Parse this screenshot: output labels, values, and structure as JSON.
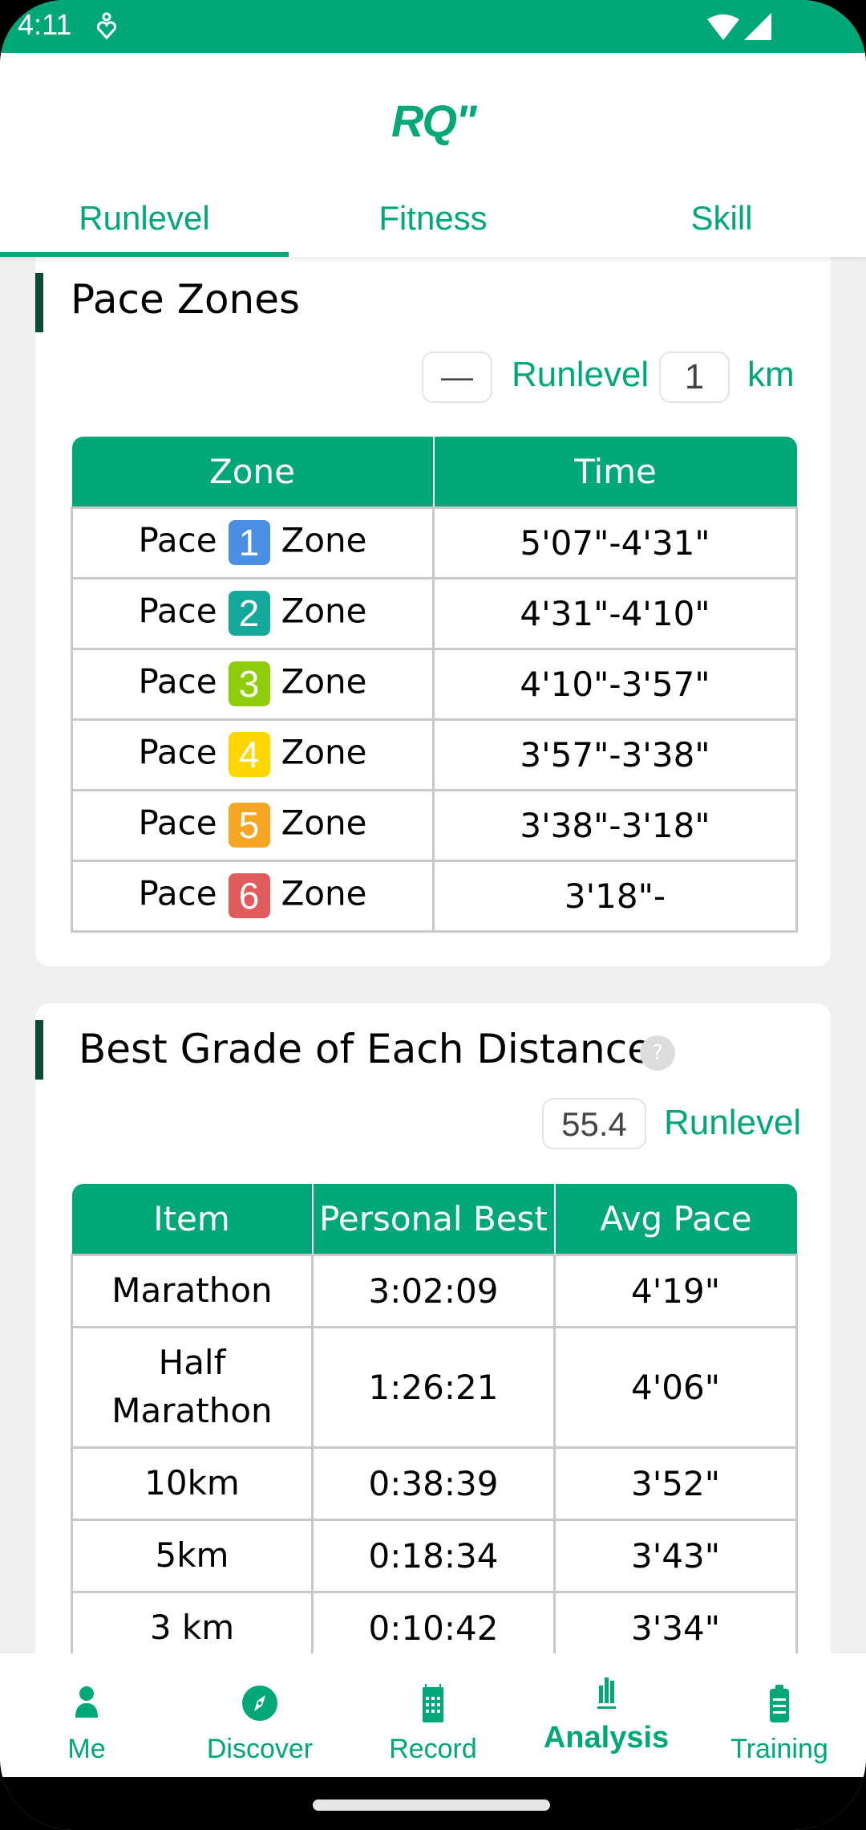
{
  "status_bar": {
    "time": "4:11",
    "icons": [
      "health-icon",
      "wifi-icon",
      "signal-icon"
    ]
  },
  "app": {
    "logo": "RQ\"",
    "brand_color": "#00a878",
    "tabs": [
      {
        "label": "Runlevel",
        "active": true
      },
      {
        "label": "Fitness",
        "active": false
      },
      {
        "label": "Skill",
        "active": false
      }
    ]
  },
  "pace_zones": {
    "title": "Pace Zones",
    "runlevel_value": "—",
    "runlevel_label": "Runlevel",
    "distance_value": "1",
    "distance_unit": "km",
    "columns": [
      "Zone",
      "Time"
    ],
    "rows": [
      {
        "prefix": "Pace",
        "zone": "1",
        "suffix": "Zone",
        "color": "#4a8fe3",
        "time": "5'07\"-4'31\""
      },
      {
        "prefix": "Pace",
        "zone": "2",
        "suffix": "Zone",
        "color": "#13a89a",
        "time": "4'31\"-4'10\""
      },
      {
        "prefix": "Pace",
        "zone": "3",
        "suffix": "Zone",
        "color": "#8fcd0a",
        "time": "4'10\"-3'57\""
      },
      {
        "prefix": "Pace",
        "zone": "4",
        "suffix": "Zone",
        "color": "#ffd600",
        "time": "3'57\"-3'38\""
      },
      {
        "prefix": "Pace",
        "zone": "5",
        "suffix": "Zone",
        "color": "#f5a623",
        "time": "3'38\"-3'18\""
      },
      {
        "prefix": "Pace",
        "zone": "6",
        "suffix": "Zone",
        "color": "#e05c5c",
        "time": "3'18\"-"
      }
    ]
  },
  "best_grade": {
    "title": "Best Grade of Each Distance",
    "help_icon": "?",
    "runlevel_value": "55.4",
    "runlevel_label": "Runlevel",
    "columns": [
      "Item",
      "Personal Best",
      "Avg Pace"
    ],
    "rows": [
      {
        "item": "Marathon",
        "best": "3:02:09",
        "pace": "4'19\""
      },
      {
        "item": "Half Marathon",
        "best": "1:26:21",
        "pace": "4'06\""
      },
      {
        "item": "10km",
        "best": "0:38:39",
        "pace": "3'52\""
      },
      {
        "item": "5km",
        "best": "0:18:34",
        "pace": "3'43\""
      },
      {
        "item": "3 km",
        "best": "0:10:42",
        "pace": "3'34\""
      }
    ]
  },
  "bottom_nav": [
    {
      "label": "Me",
      "icon": "person-icon",
      "active": false
    },
    {
      "label": "Discover",
      "icon": "compass-icon",
      "active": false
    },
    {
      "label": "Record",
      "icon": "calendar-icon",
      "active": false
    },
    {
      "label": "Analysis",
      "icon": "bar-chart-icon",
      "active": true
    },
    {
      "label": "Training",
      "icon": "clipboard-icon",
      "active": false
    }
  ]
}
